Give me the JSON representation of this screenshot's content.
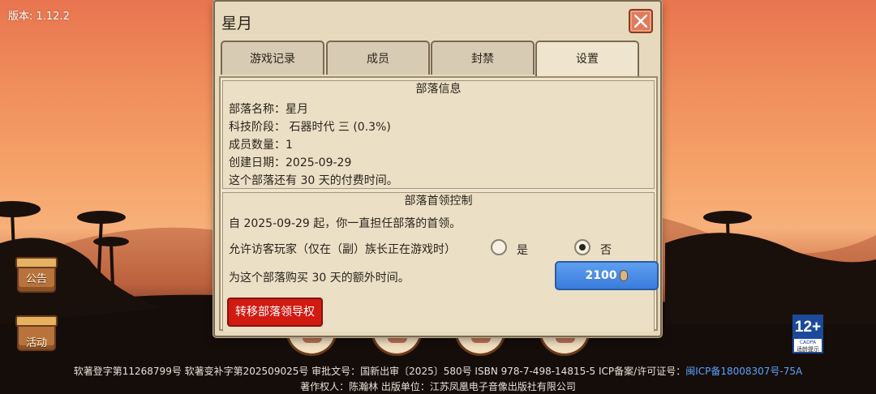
{
  "version": "版本: 1.12.2",
  "side_buttons": {
    "notice": "公告",
    "activity": "活动"
  },
  "dialog": {
    "title": "星月",
    "tabs": [
      "游戏记录",
      "成员",
      "封禁",
      "设置"
    ],
    "active_tab": "设置",
    "tribe_info": {
      "heading": "部落信息",
      "name": "部落名称：星月",
      "tech": "科技阶段： 石器时代 三 (0.3%)",
      "members": "成员数量：1",
      "created": "创建日期：2025-09-29",
      "paid": "这个部落还有 30 天的付费时间。"
    },
    "leader_control": {
      "heading": "部落首领控制",
      "since": "自 2025-09-29 起，你一直担任部落的首领。",
      "visitor_label": "允许访客玩家（仅在（副）族长正在游戏时）",
      "yes": "是",
      "no": "否",
      "selected": "否",
      "buy_label": "为这个部落购买 30 天的额外时间。",
      "buy_price": "2100",
      "transfer": "转移部落领导权"
    }
  },
  "age_badge": {
    "rating": "12+",
    "org": "CADPA",
    "text": "适龄提示"
  },
  "footer": {
    "line1": "软著登字第11268799号 软著变补字第202509025号 审批文号：国新出审〔2025〕580号 ISBN 978-7-498-14815-5 ICP备案/许可证号：",
    "icp_link": "闽ICP备18008307号-75A",
    "line2": "著作权人：陈瀚林 出版单位：江苏凤凰电子音像出版社有限公司"
  },
  "colors": {
    "accent_blue": "#3a7cdc",
    "danger_red": "#d11a12",
    "panel": "#efe5cf"
  }
}
